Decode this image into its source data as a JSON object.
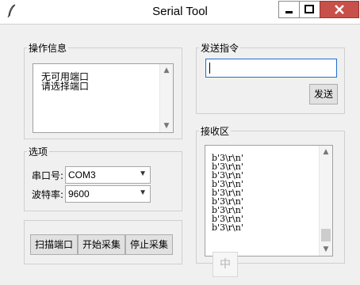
{
  "window": {
    "title": "Serial Tool"
  },
  "info_group": {
    "legend": "操作信息",
    "lines": [
      "无可用端口",
      "请选择端口"
    ]
  },
  "options_group": {
    "legend": "选项",
    "port_label": "串口号:",
    "port_value": "COM3",
    "baud_label": "波特率:",
    "baud_value": "9600"
  },
  "buttons": {
    "scan": "扫描端口",
    "start": "开始采集",
    "stop": "停止采集"
  },
  "send_group": {
    "legend": "发送指令",
    "input_value": "",
    "send_button": "发送"
  },
  "receive_group": {
    "legend": "接收区",
    "lines": [
      "b'3\\r\\n'",
      "b'3\\r\\n'",
      "b'3\\r\\n'",
      "b'3\\r\\n'",
      "b'3\\r\\n'",
      "b'3\\r\\n'",
      "b'3\\r\\n'",
      "b'3\\r\\n'",
      "b'3\\r\\n'"
    ]
  },
  "ime": {
    "label": "中"
  },
  "icons": {
    "app": "feather-icon",
    "minimize": "minimize-icon",
    "maximize": "maximize-icon",
    "close": "close-icon"
  },
  "colors": {
    "close_button": "#c7504b",
    "input_focus_border": "#1f6fd0"
  }
}
